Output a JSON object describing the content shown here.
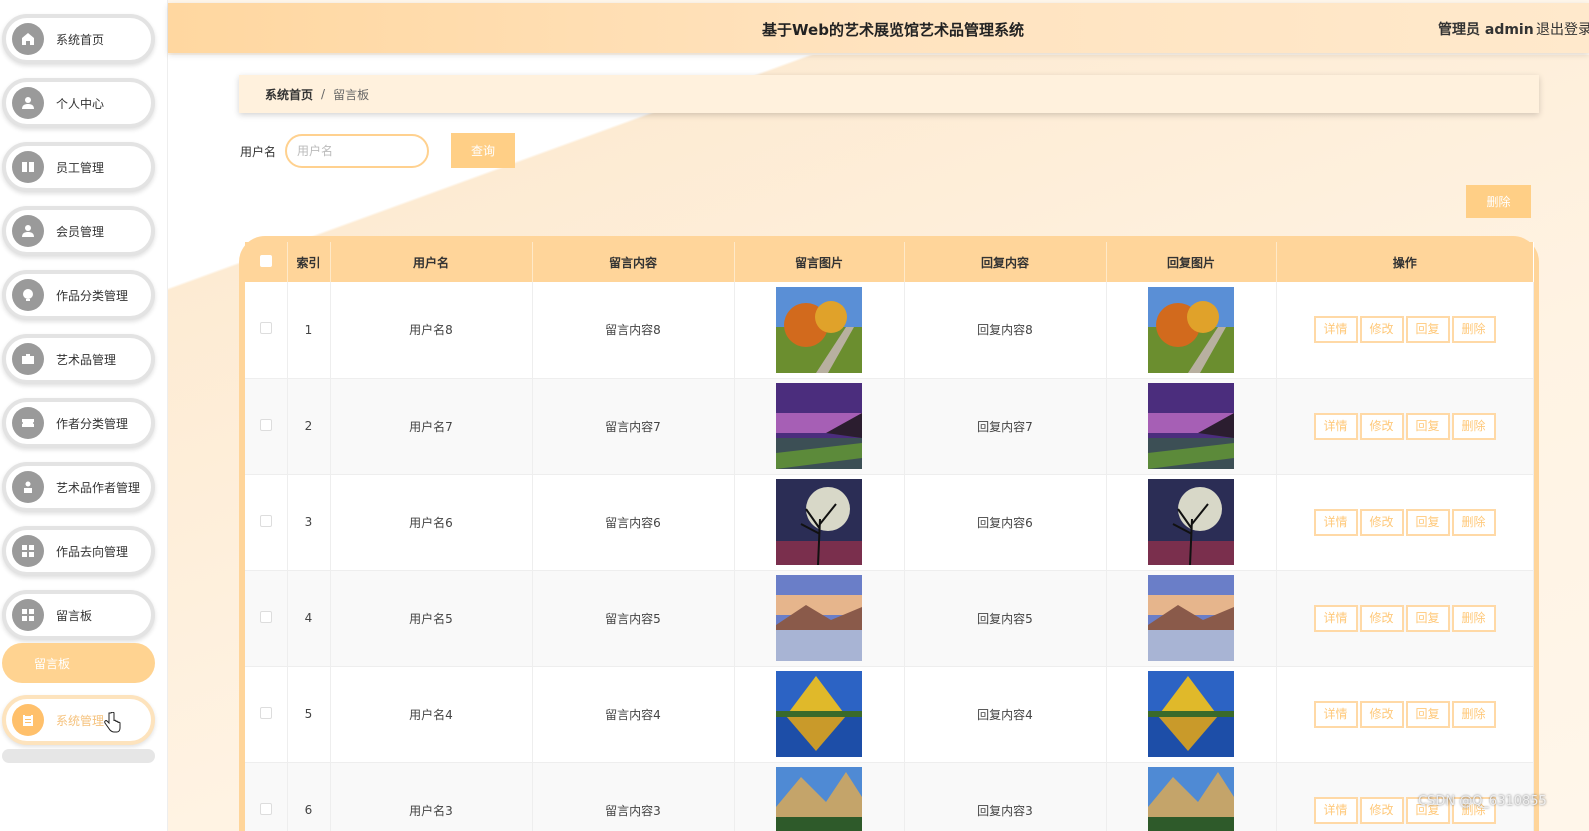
{
  "header": {
    "title": "基于Web的艺术展览馆艺术品管理系统",
    "user": "管理员 admin",
    "logout": "退出登录"
  },
  "sidebar": {
    "items": [
      {
        "label": "系统首页",
        "icon": "home-icon"
      },
      {
        "label": "个人中心",
        "icon": "user-icon"
      },
      {
        "label": "员工管理",
        "icon": "id-card-icon"
      },
      {
        "label": "会员管理",
        "icon": "user-icon"
      },
      {
        "label": "作品分类管理",
        "icon": "bulb-icon"
      },
      {
        "label": "艺术品管理",
        "icon": "briefcase-icon"
      },
      {
        "label": "作者分类管理",
        "icon": "ticket-icon"
      },
      {
        "label": "艺术品作者管理",
        "icon": "person-icon"
      },
      {
        "label": "作品去向管理",
        "icon": "grid-icon"
      },
      {
        "label": "留言板",
        "icon": "grid-icon"
      }
    ],
    "sub_item": "留言板",
    "system": {
      "label": "系统管理",
      "icon": "clipboard-icon"
    }
  },
  "breadcrumb": {
    "home": "系统首页",
    "separator": "/",
    "current": "留言板"
  },
  "search": {
    "label": "用户名",
    "placeholder": "用户名",
    "button": "查询"
  },
  "delete_button": "删除",
  "table": {
    "headers": [
      "索引",
      "用户名",
      "留言内容",
      "留言图片",
      "回复内容",
      "回复图片",
      "操作"
    ],
    "actions": [
      "详情",
      "修改",
      "回复",
      "删除"
    ],
    "rows": [
      {
        "index": "1",
        "username": "用户名8",
        "content": "留言内容8",
        "reply": "回复内容8",
        "image": "autumn"
      },
      {
        "index": "2",
        "username": "用户名7",
        "content": "留言内容7",
        "reply": "回复内容7",
        "image": "coast"
      },
      {
        "index": "3",
        "username": "用户名6",
        "content": "留言内容6",
        "reply": "回复内容6",
        "image": "moon"
      },
      {
        "index": "4",
        "username": "用户名5",
        "content": "留言内容5",
        "reply": "回复内容5",
        "image": "lake"
      },
      {
        "index": "5",
        "username": "用户名4",
        "content": "留言内容4",
        "reply": "回复内容4",
        "image": "mountain"
      },
      {
        "index": "6",
        "username": "用户名3",
        "content": "留言内容3",
        "reply": "回复内容3",
        "image": "valley"
      }
    ]
  },
  "watermark": "CSDN @Q_6310855",
  "colors": {
    "accent": "#ffd59a",
    "button": "#ffcf86",
    "sub_active": "#ffd391"
  }
}
